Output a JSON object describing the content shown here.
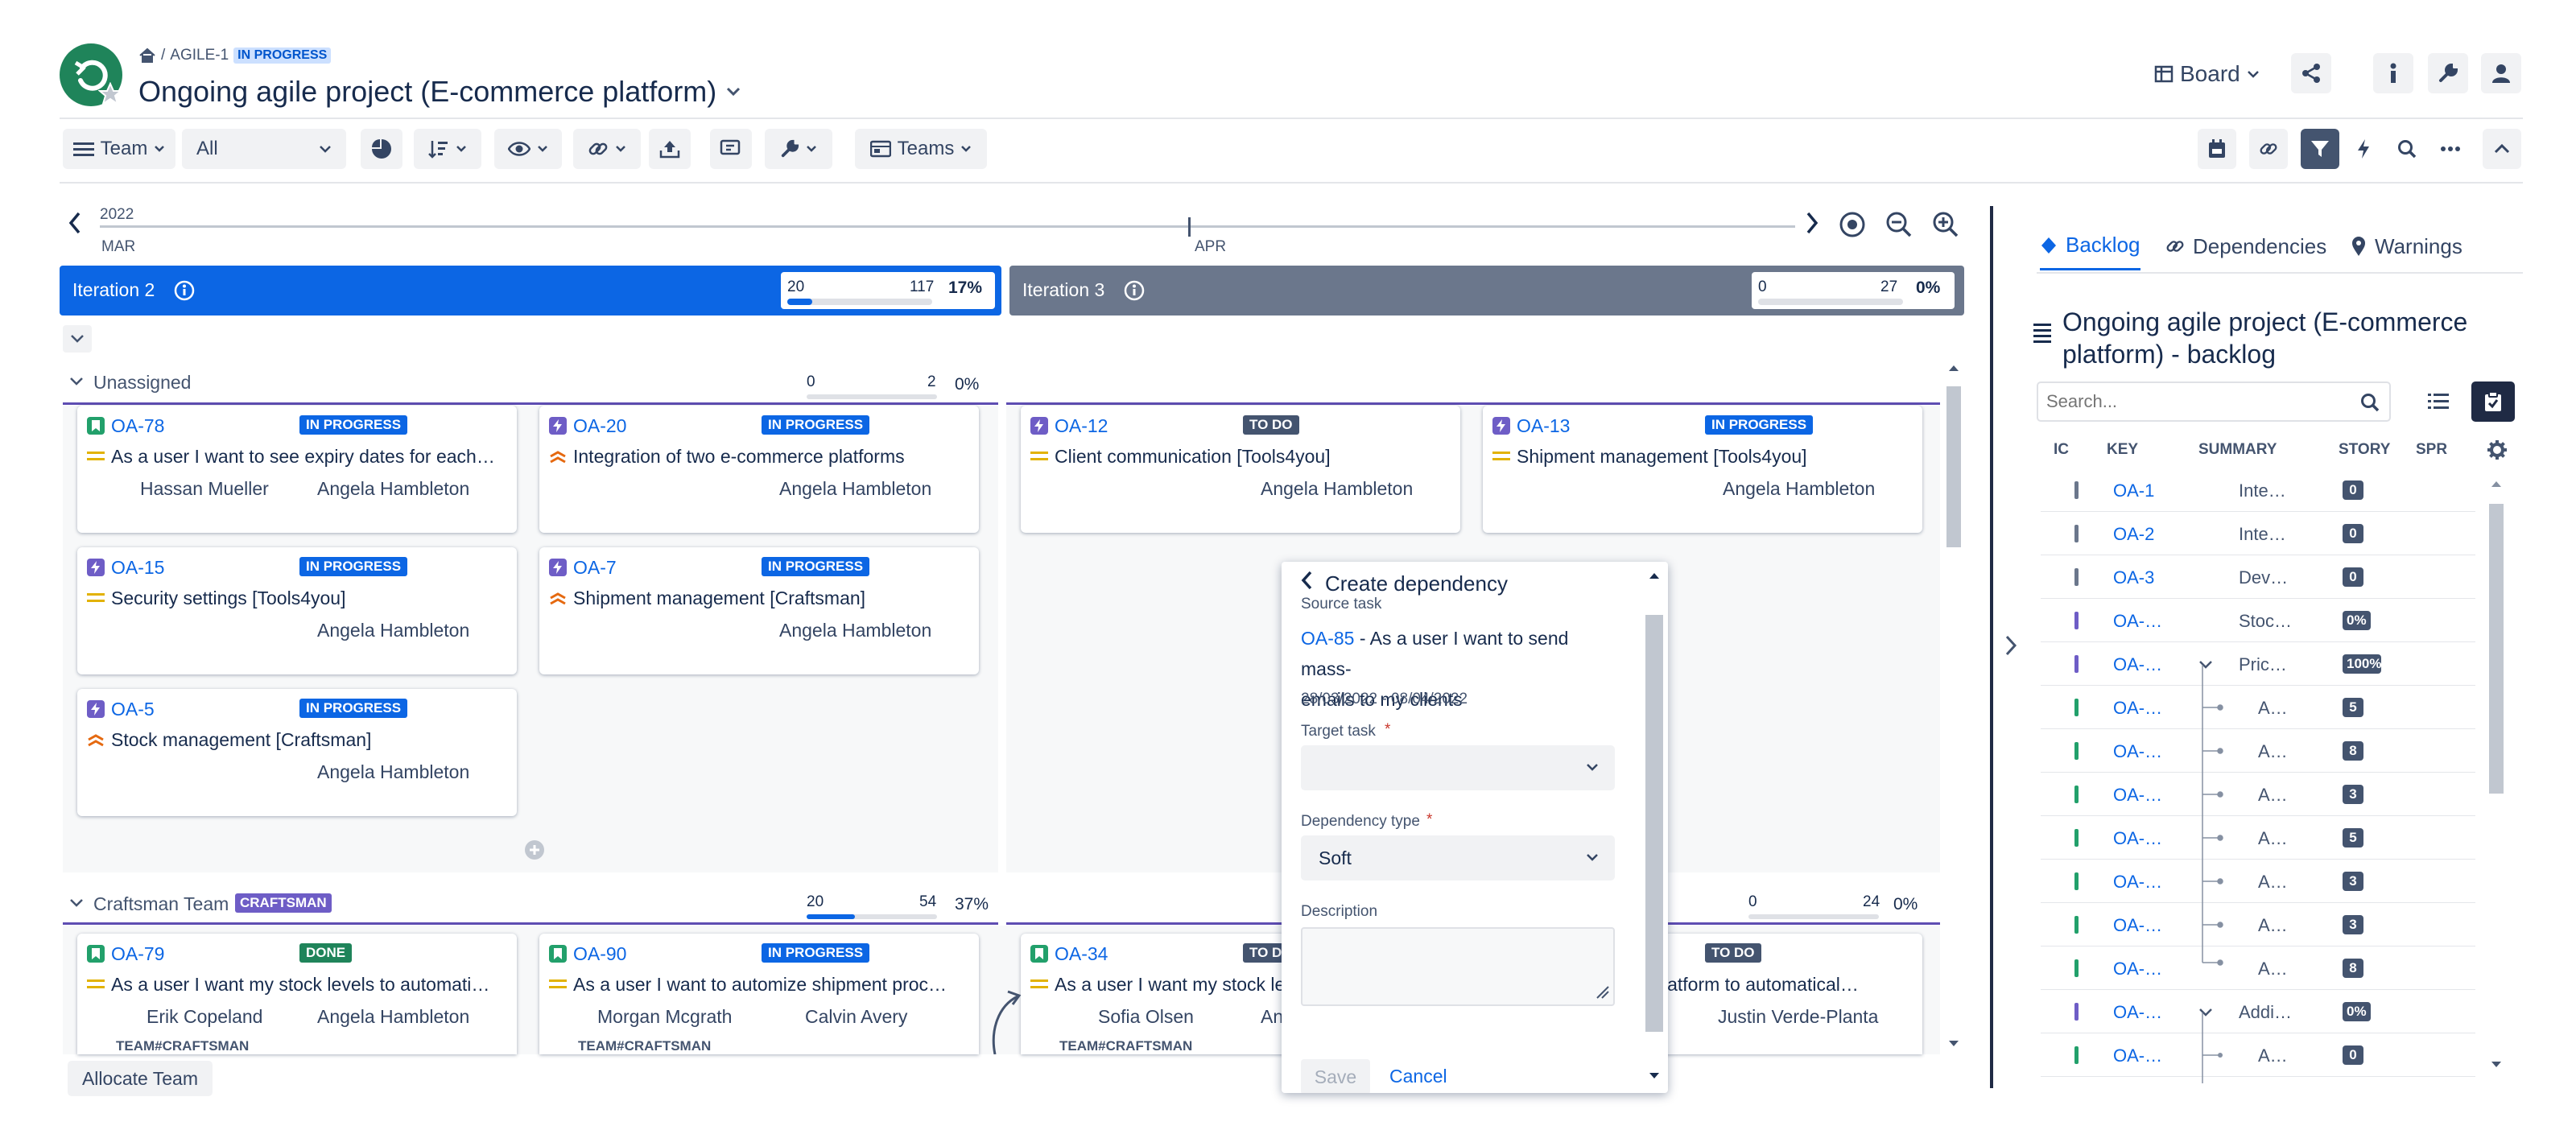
{
  "header": {
    "breadcrumb_key": "AGILE-1",
    "breadcrumb_sep": "/",
    "status": "IN PROGRESS",
    "title": "Ongoing agile project (E-commerce platform)",
    "board_label": "Board"
  },
  "toolbar": {
    "team_label": "Team",
    "filter_value": "All",
    "teams_label": "Teams"
  },
  "timeline": {
    "year": "2022",
    "month_start": "MAR",
    "month_mid": "APR"
  },
  "iterations": [
    {
      "name": "Iteration 2",
      "start": "20",
      "end": "117",
      "pct": "17%",
      "fill": 0.17,
      "color": "#0c66e4"
    },
    {
      "name": "Iteration 3",
      "start": "0",
      "end": "27",
      "pct": "0%",
      "fill": 0.0,
      "color": "#6b778c"
    }
  ],
  "lanes": {
    "unassigned": {
      "label": "Unassigned",
      "start": "0",
      "end": "2",
      "pct": "0%",
      "fill": 0.0
    },
    "craftsman": {
      "label": "Craftsman Team",
      "badge": "CRAFTSMAN",
      "start": "20",
      "end": "54",
      "pct": "37%",
      "fill": 0.37,
      "start2": "0",
      "end2": "24",
      "pct2": "0%",
      "fill2": 0.0
    }
  },
  "cards": [
    {
      "key": "OA-78",
      "status": "IN PROGRESS",
      "summary": "As a user I want to see expiry dates for each…",
      "a1": "Hassan Mueller",
      "a2": "Angela Hambleton"
    },
    {
      "key": "OA-20",
      "status": "IN PROGRESS",
      "summary": "Integration of two e-commerce platforms",
      "a1": "",
      "a2": "Angela Hambleton"
    },
    {
      "key": "OA-12",
      "status": "TO DO",
      "summary": "Client communication [Tools4you]",
      "a1": "",
      "a2": "Angela Hambleton"
    },
    {
      "key": "OA-13",
      "status": "IN PROGRESS",
      "summary": "Shipment management [Tools4you]",
      "a1": "",
      "a2": "Angela Hambleton"
    },
    {
      "key": "OA-15",
      "status": "IN PROGRESS",
      "summary": "Security settings [Tools4you]",
      "a1": "",
      "a2": "Angela Hambleton"
    },
    {
      "key": "OA-7",
      "status": "IN PROGRESS",
      "summary": "Shipment management [Craftsman]",
      "a1": "",
      "a2": "Angela Hambleton"
    },
    {
      "key": "OA-5",
      "status": "IN PROGRESS",
      "summary": "Stock management [Craftsman]",
      "a1": "",
      "a2": "Angela Hambleton"
    },
    {
      "key": "OA-79",
      "status": "DONE",
      "summary": "As a user I want my stock levels to automati…",
      "a1": "Erik Copeland",
      "a2": "Angela Hambleton",
      "tag": "TEAM#CRAFTSMAN"
    },
    {
      "key": "OA-90",
      "status": "IN PROGRESS",
      "summary": "As a user I want to automize shipment proc…",
      "a1": "Morgan Mcgrath",
      "a2": "Calvin Avery",
      "tag": "TEAM#CRAFTSMAN"
    },
    {
      "key": "OA-34",
      "status": "TO DO",
      "summary": "As a user I want my stock le",
      "a1": "Sofia Olsen",
      "a2": "An",
      "tag": "TEAM#CRAFTSMAN"
    },
    {
      "key": "",
      "status": "TO DO",
      "summary": "e platform to automatical…",
      "a1": "",
      "a2": "Justin Verde-Planta"
    }
  ],
  "dialog": {
    "title": "Create dependency",
    "source_label": "Source task",
    "source_key": "OA-85",
    "source_text": " - As a user I want to send mass-",
    "source_text2": "emails to my clients",
    "dates": "28/03/2022 - 08/04/2022",
    "target_label": "Target task",
    "dep_label": "Dependency type",
    "dep_value": "Soft",
    "desc_label": "Description",
    "save": "Save",
    "cancel": "Cancel"
  },
  "footer": {
    "allocate": "Allocate Team"
  },
  "panel": {
    "tabs": [
      "Backlog",
      "Dependencies",
      "Warnings"
    ],
    "title": "Ongoing agile project (E-commerce platform) - backlog",
    "search_placeholder": "Search...",
    "cols": [
      "IC",
      "KEY",
      "SUMMARY",
      "STORY",
      "SPR"
    ],
    "rows": [
      {
        "key": "OA-1",
        "summary": "Inte…",
        "pts": "0"
      },
      {
        "key": "OA-2",
        "summary": "Inte…",
        "pts": "0"
      },
      {
        "key": "OA-3",
        "summary": "Dev…",
        "pts": "0"
      },
      {
        "key": "OA-…",
        "summary": "Stoc…",
        "pts": "0%"
      },
      {
        "key": "OA-…",
        "summary": "Pric…",
        "pts": "100%"
      },
      {
        "key": "OA-…",
        "summary": "A…",
        "pts": "5"
      },
      {
        "key": "OA-…",
        "summary": "A…",
        "pts": "8"
      },
      {
        "key": "OA-…",
        "summary": "A…",
        "pts": "3"
      },
      {
        "key": "OA-…",
        "summary": "A…",
        "pts": "5"
      },
      {
        "key": "OA-…",
        "summary": "A…",
        "pts": "3"
      },
      {
        "key": "OA-…",
        "summary": "A…",
        "pts": "3"
      },
      {
        "key": "OA-…",
        "summary": "A…",
        "pts": "8"
      },
      {
        "key": "OA-…",
        "summary": "Addi…",
        "pts": "0%"
      },
      {
        "key": "OA-…",
        "summary": "A…",
        "pts": "0"
      }
    ]
  },
  "colors": {
    "primary": "#0c66e4",
    "story": "#22a06b",
    "epic": "#6e5dc6",
    "priority_medium": "#e2b203",
    "priority_high": "#e56910",
    "badge_progress": "#0c66e4",
    "badge_done": "#1f845a",
    "badge_todo": "#44546f"
  }
}
